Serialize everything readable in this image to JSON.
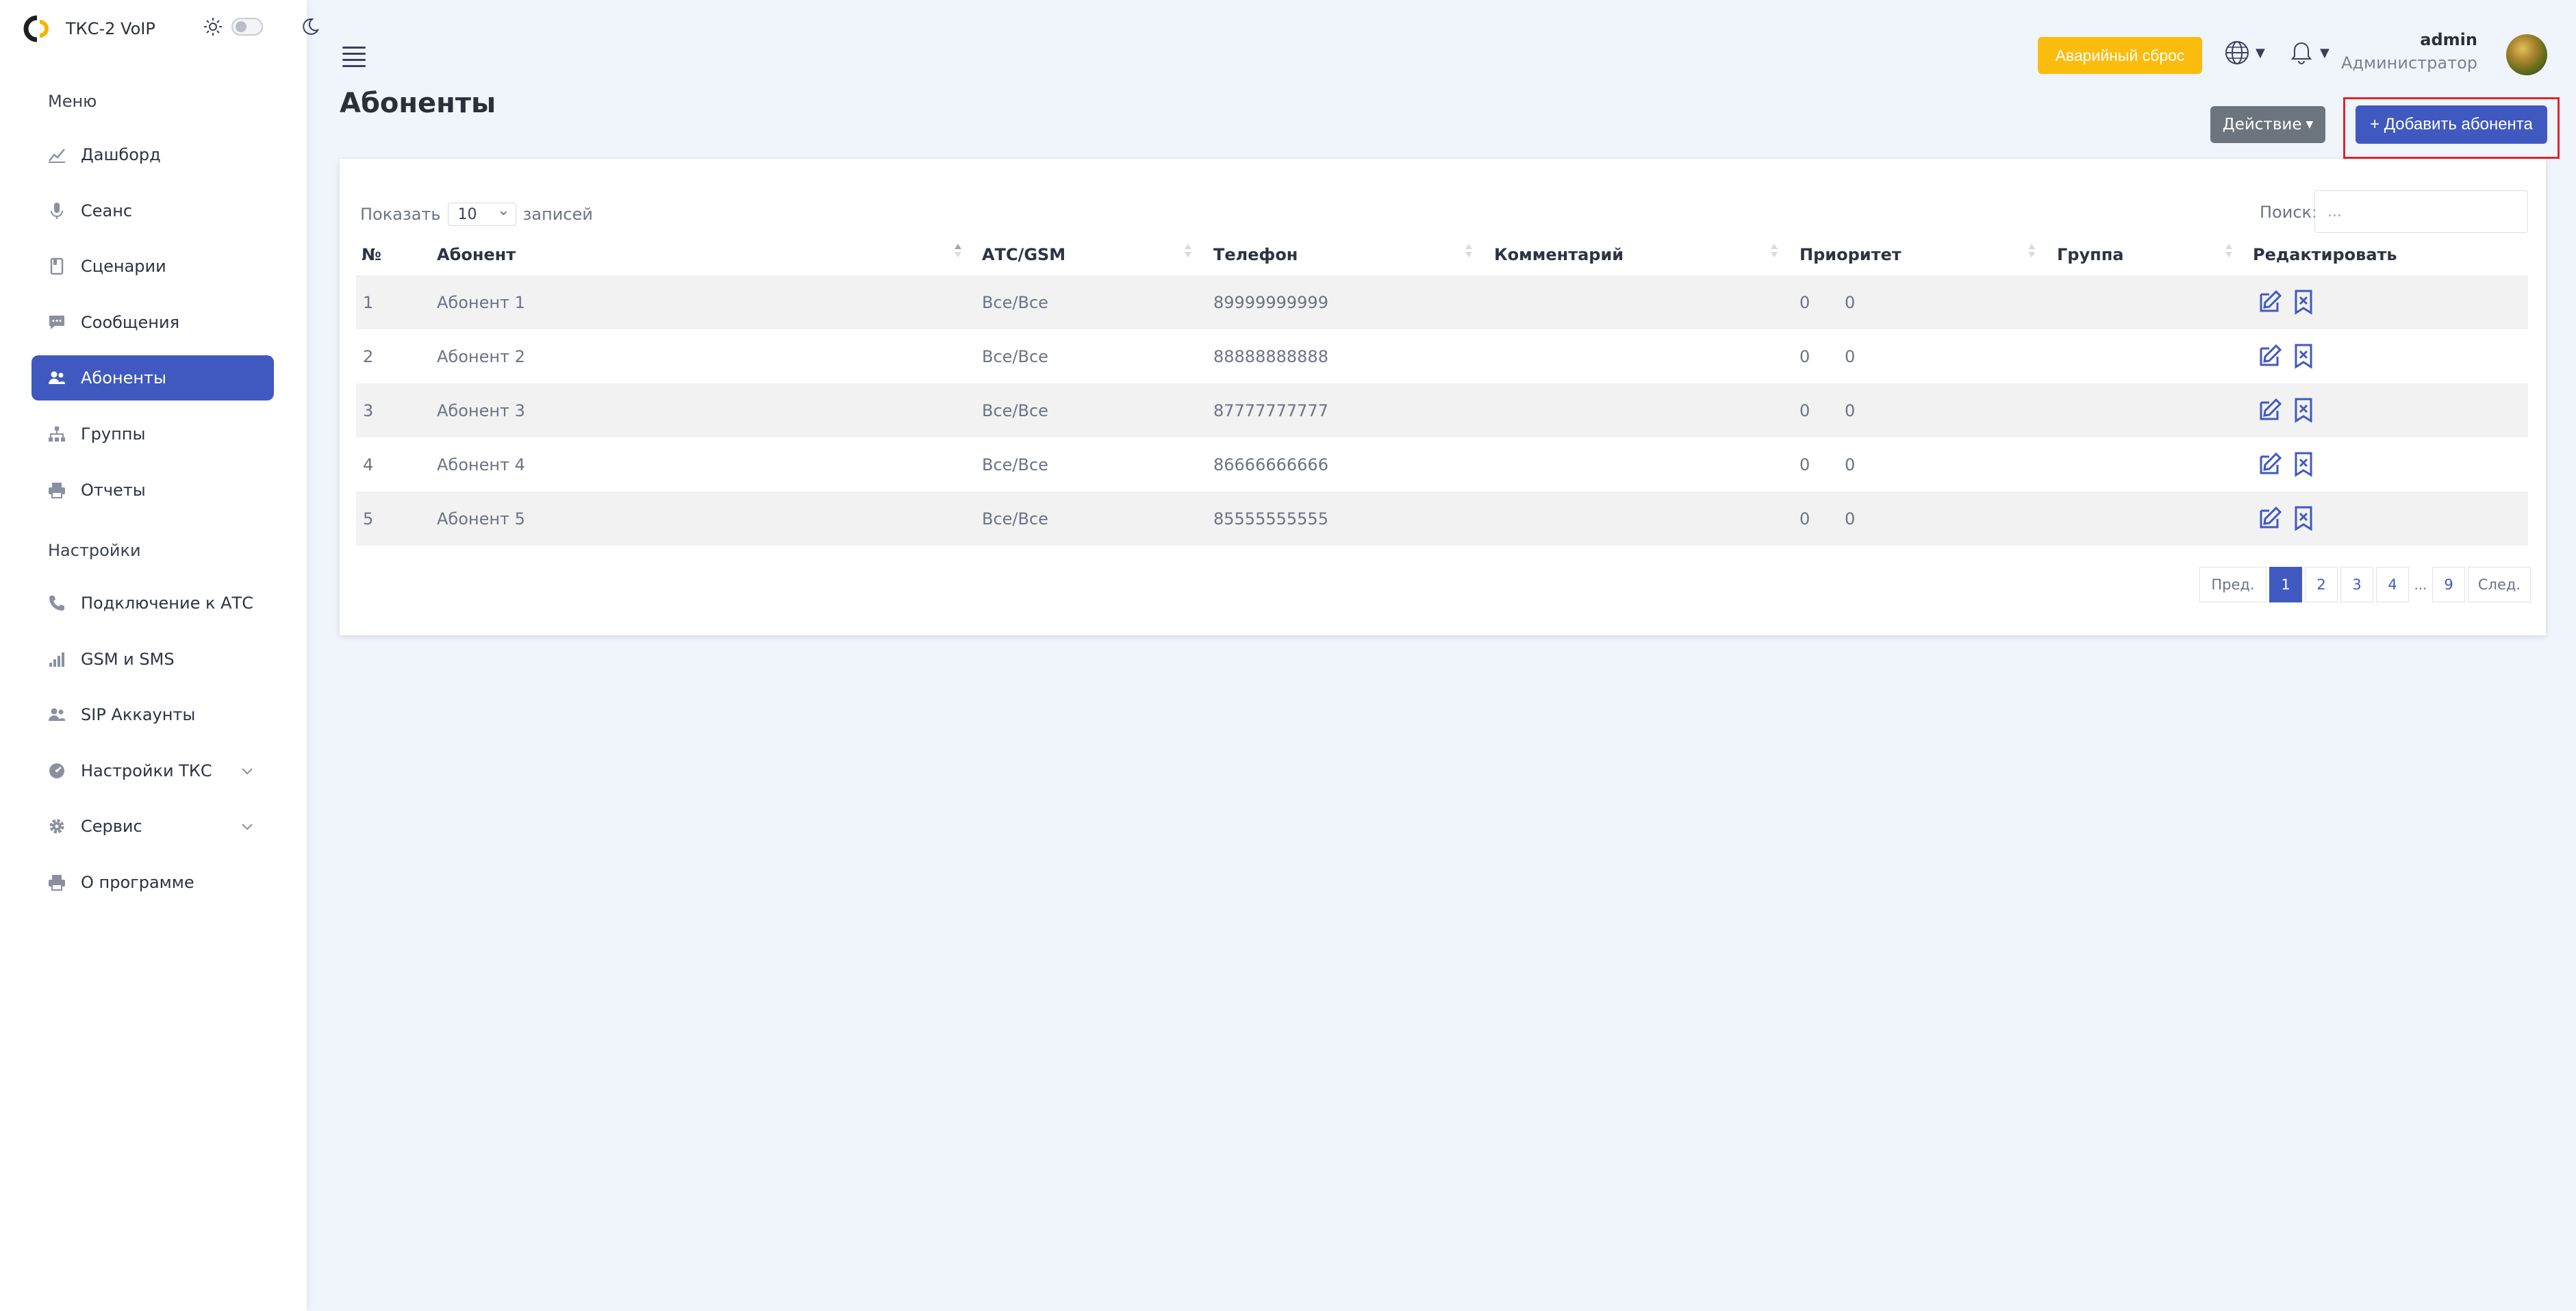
{
  "app": {
    "brand_name": "ТКС-2 VoIP",
    "accent_color": "#4059c0"
  },
  "sidebar": {
    "menu_header": "Меню",
    "settings_header": "Настройки",
    "menu_items": [
      {
        "label": "Дашборд",
        "icon": "chart-line-icon"
      },
      {
        "label": "Сеанс",
        "icon": "microphone-icon"
      },
      {
        "label": "Сценарии",
        "icon": "book-icon"
      },
      {
        "label": "Сообщения",
        "icon": "chat-icon"
      },
      {
        "label": "Абоненты",
        "icon": "users-icon",
        "active": true
      },
      {
        "label": "Группы",
        "icon": "sitemap-icon"
      },
      {
        "label": "Отчеты",
        "icon": "printer-icon"
      }
    ],
    "settings_items": [
      {
        "label": "Подключение к АТС",
        "icon": "phone-icon"
      },
      {
        "label": "GSM и SMS",
        "icon": "signal-bars-icon"
      },
      {
        "label": "SIP Аккаунты",
        "icon": "users-icon"
      },
      {
        "label": "Настройки ТКС",
        "icon": "gauge-icon",
        "has_submenu": true
      },
      {
        "label": "Сервис",
        "icon": "gear-icon",
        "has_submenu": true
      },
      {
        "label": "О программе",
        "icon": "printer-icon"
      }
    ]
  },
  "topbar": {
    "emergency_label": "Аварийный сброс",
    "user_name": "admin",
    "user_role": "Администратор"
  },
  "page": {
    "title": "Абоненты",
    "action_label": "Действие",
    "add_label": "+ Добавить абонента"
  },
  "table": {
    "show_prefix": "Показать",
    "page_size": "10",
    "show_suffix": "записей",
    "search_label": "Поиск:",
    "search_placeholder": "...",
    "columns": [
      "№",
      "Абонент",
      "АТС/GSM",
      "Телефон",
      "Комментарий",
      "Приоритет",
      "Группа",
      "Редактировать"
    ],
    "rows": [
      {
        "num": "1",
        "name": "Абонент 1",
        "ats": "Все/Все",
        "phone": "89999999999",
        "comment": "",
        "priority_a": "0",
        "priority_b": "0",
        "group": ""
      },
      {
        "num": "2",
        "name": "Абонент 2",
        "ats": "Все/Все",
        "phone": "88888888888",
        "comment": "",
        "priority_a": "0",
        "priority_b": "0",
        "group": ""
      },
      {
        "num": "3",
        "name": "Абонент 3",
        "ats": "Все/Все",
        "phone": "87777777777",
        "comment": "",
        "priority_a": "0",
        "priority_b": "0",
        "group": ""
      },
      {
        "num": "4",
        "name": "Абонент 4",
        "ats": "Все/Все",
        "phone": "86666666666",
        "comment": "",
        "priority_a": "0",
        "priority_b": "0",
        "group": ""
      },
      {
        "num": "5",
        "name": "Абонент 5",
        "ats": "Все/Все",
        "phone": "85555555555",
        "comment": "",
        "priority_a": "0",
        "priority_b": "0",
        "group": ""
      }
    ]
  },
  "pagination": {
    "prev": "Пред.",
    "pages": [
      "1",
      "2",
      "3",
      "4"
    ],
    "ellipsis": "...",
    "last": "9",
    "next": "След.",
    "current": "1"
  }
}
